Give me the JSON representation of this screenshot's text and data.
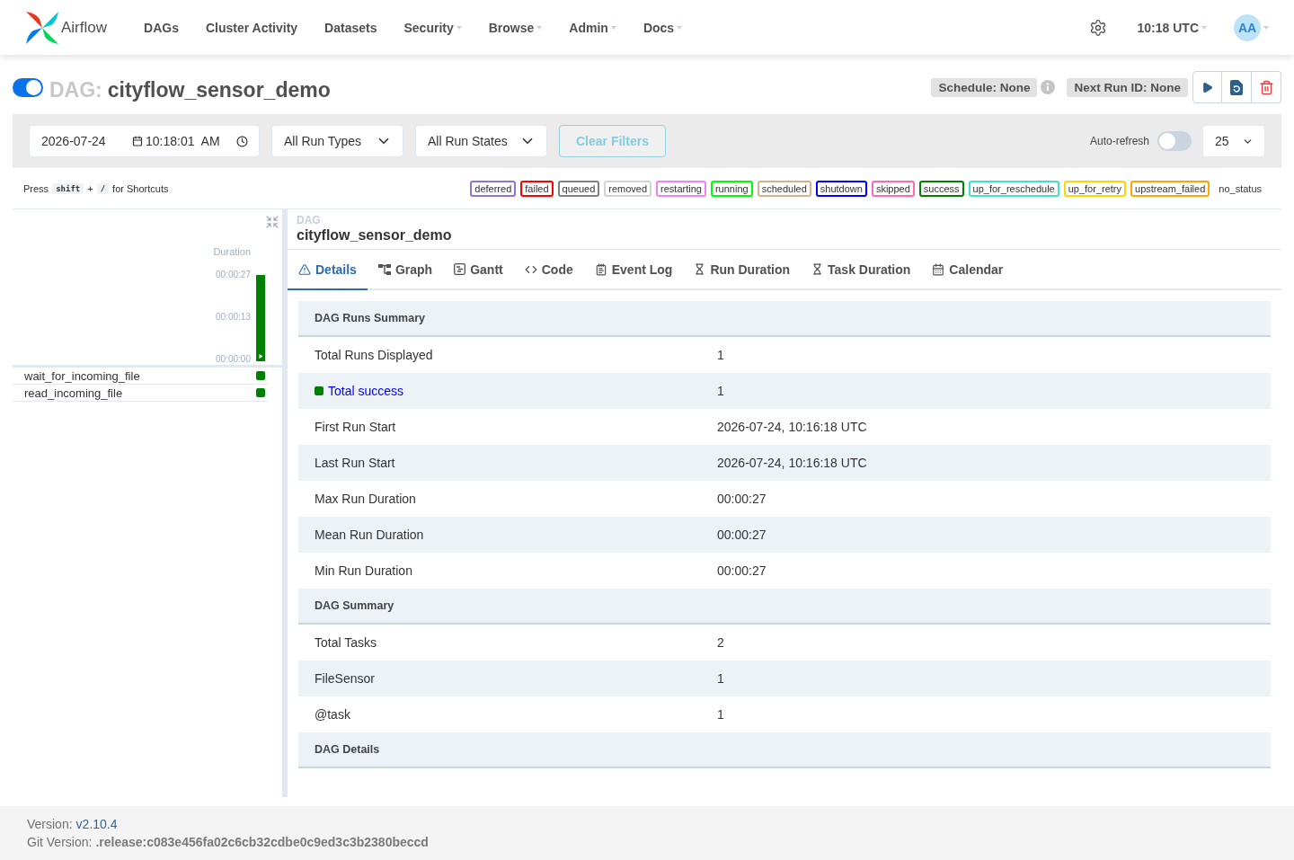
{
  "navbar": {
    "brand": "Airflow",
    "menu": [
      {
        "label": "DAGs",
        "dropdown": false
      },
      {
        "label": "Cluster Activity",
        "dropdown": false
      },
      {
        "label": "Datasets",
        "dropdown": false
      },
      {
        "label": "Security",
        "dropdown": true
      },
      {
        "label": "Browse",
        "dropdown": true
      },
      {
        "label": "Admin",
        "dropdown": true
      },
      {
        "label": "Docs",
        "dropdown": true
      }
    ],
    "clock": "10:18 UTC",
    "avatar": "AA"
  },
  "dag_header": {
    "active": true,
    "prefix": "DAG:",
    "name": "cityflow_sensor_demo",
    "schedule": "Schedule: None",
    "next_run": "Next Run ID: None"
  },
  "filters": {
    "date": "2026-07-24",
    "time": "10:18:01 AM",
    "run_type": "All Run Types",
    "run_state": "All Run States",
    "clear_button": "Clear Filters",
    "auto_refresh": {
      "label": "Auto-refresh",
      "on": false
    },
    "page_size": "25"
  },
  "shortcuts": {
    "before": "Press",
    "keys": [
      "shift",
      "/"
    ],
    "joiner": "+",
    "after": "for Shortcuts"
  },
  "legend": [
    {
      "label": "deferred",
      "color": "#9370db"
    },
    {
      "label": "failed",
      "color": "#ff0000"
    },
    {
      "label": "queued",
      "color": "#808080"
    },
    {
      "label": "removed",
      "color": "#d3d3d3"
    },
    {
      "label": "restarting",
      "color": "#ee82ee"
    },
    {
      "label": "running",
      "color": "#00ff00"
    },
    {
      "label": "scheduled",
      "color": "#d2b48c"
    },
    {
      "label": "shutdown",
      "color": "#0000ff"
    },
    {
      "label": "skipped",
      "color": "#ff69b4"
    },
    {
      "label": "success",
      "color": "#008000"
    },
    {
      "label": "up_for_reschedule",
      "color": "#40e0d0"
    },
    {
      "label": "up_for_retry",
      "color": "#ffd700"
    },
    {
      "label": "upstream_failed",
      "color": "#ffa500"
    },
    {
      "label": "no_status"
    }
  ],
  "grid": {
    "duration_axis": {
      "title": "Duration",
      "ticks": [
        "00:00:27",
        "00:00:13",
        "00:00:00"
      ]
    },
    "runs": [
      {
        "color": "#008000"
      }
    ],
    "tasks": [
      {
        "name": "wait_for_incoming_file",
        "color": "#008000"
      },
      {
        "name": "read_incoming_file",
        "color": "#008000"
      }
    ]
  },
  "details": {
    "kicker": "DAG",
    "title": "cityflow_sensor_demo",
    "tabs": [
      {
        "label": "Details",
        "selected": true
      },
      {
        "label": "Graph",
        "selected": false
      },
      {
        "label": "Gantt",
        "selected": false
      },
      {
        "label": "Code",
        "selected": false
      },
      {
        "label": "Event Log",
        "selected": false
      },
      {
        "label": "Run Duration",
        "selected": false
      },
      {
        "label": "Task Duration",
        "selected": false
      },
      {
        "label": "Calendar",
        "selected": false
      }
    ],
    "sections": [
      {
        "title": "DAG Runs Summary",
        "rows": [
          {
            "kind": "text",
            "label": "Total Runs Displayed",
            "value": "1"
          },
          {
            "kind": "state",
            "label": "Total success",
            "color": "#008000",
            "value": "1"
          },
          {
            "kind": "text",
            "label": "First Run Start",
            "value": "2026-07-24, 10:16:18 UTC"
          },
          {
            "kind": "text",
            "label": "Last Run Start",
            "value": "2026-07-24, 10:16:18 UTC"
          },
          {
            "kind": "text",
            "label": "Max Run Duration",
            "value": "00:00:27"
          },
          {
            "kind": "text",
            "label": "Mean Run Duration",
            "value": "00:00:27"
          },
          {
            "kind": "text",
            "label": "Min Run Duration",
            "value": "00:00:27"
          }
        ]
      },
      {
        "title": "DAG Summary",
        "rows": [
          {
            "kind": "text",
            "label": "Total Tasks",
            "value": "2"
          },
          {
            "kind": "text",
            "label": "FileSensor",
            "value": "1"
          },
          {
            "kind": "text",
            "label": "@task",
            "value": "1"
          }
        ]
      },
      {
        "title": "DAG Details"
      }
    ]
  },
  "footer": {
    "version_label": "Version:",
    "version": "v2.10.4",
    "git_label": "Git Version:",
    "git": ".release:c083e456fa02c6cb32cdbe0c9ed3c3b2380beccd"
  }
}
